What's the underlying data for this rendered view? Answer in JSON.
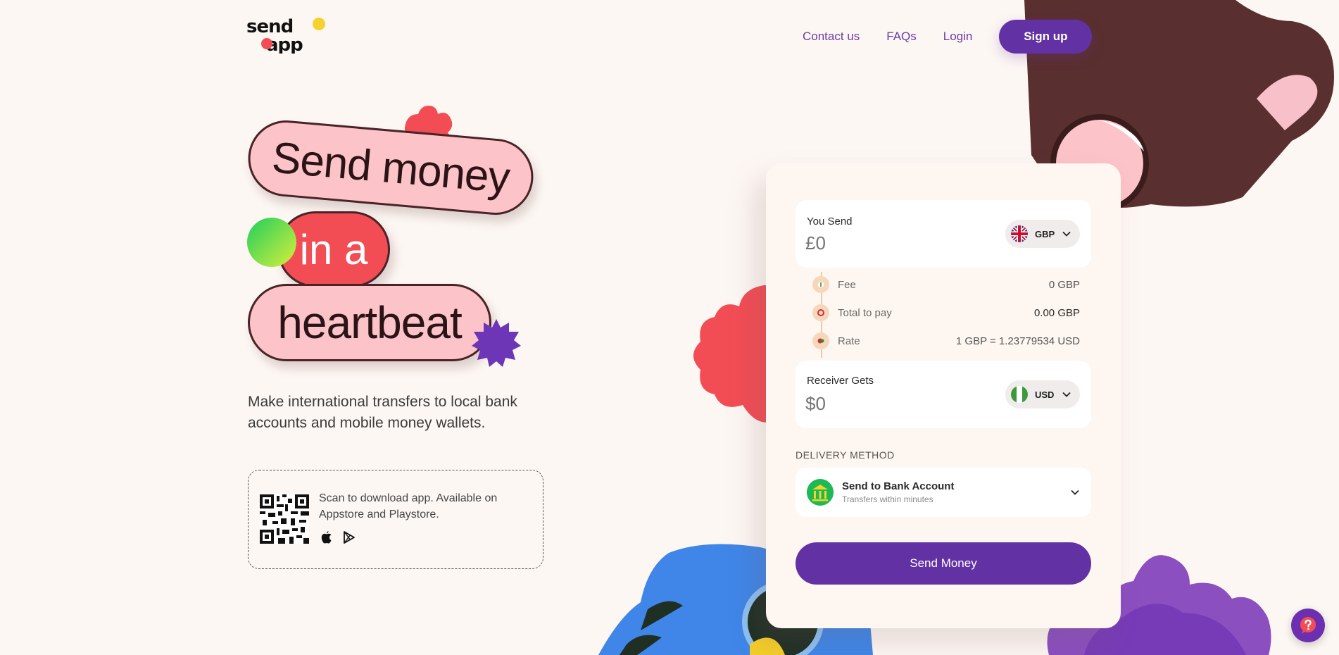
{
  "brand": {
    "logo_line1": "send",
    "logo_line2": "app"
  },
  "nav": {
    "contact": "Contact us",
    "faqs": "FAQs",
    "login": "Login",
    "signup": "Sign up"
  },
  "hero": {
    "line1": "Send money",
    "line2": "in a",
    "line3": "heartbeat",
    "subtitle": "Make international transfers to local bank accounts and mobile money wallets."
  },
  "download": {
    "text": "Scan to download app. Available on Appstore and Playstore.",
    "icons": [
      "apple-icon",
      "play-store-icon"
    ]
  },
  "calculator": {
    "send": {
      "label": "You Send",
      "amount": "£0",
      "currency": "GBP",
      "flag": "uk-flag-icon"
    },
    "fee": {
      "label": "Fee",
      "value": "0 GBP"
    },
    "total": {
      "label": "Total to pay",
      "value": "0.00 GBP"
    },
    "rate": {
      "label": "Rate",
      "value": "1 GBP = 1.23779534 USD"
    },
    "receive": {
      "label": "Receiver Gets",
      "amount": "$0",
      "currency": "USD",
      "flag": "nigeria-flag-icon"
    },
    "delivery": {
      "section_label": "DELIVERY METHOD",
      "title": "Send to Bank Account",
      "subtitle": "Transfers within minutes"
    },
    "submit": "Send Money"
  },
  "colors": {
    "accent": "#6232a4",
    "pill_pink": "#fcc3c8",
    "pill_red": "#f24d55",
    "background": "#fdf7f3"
  }
}
